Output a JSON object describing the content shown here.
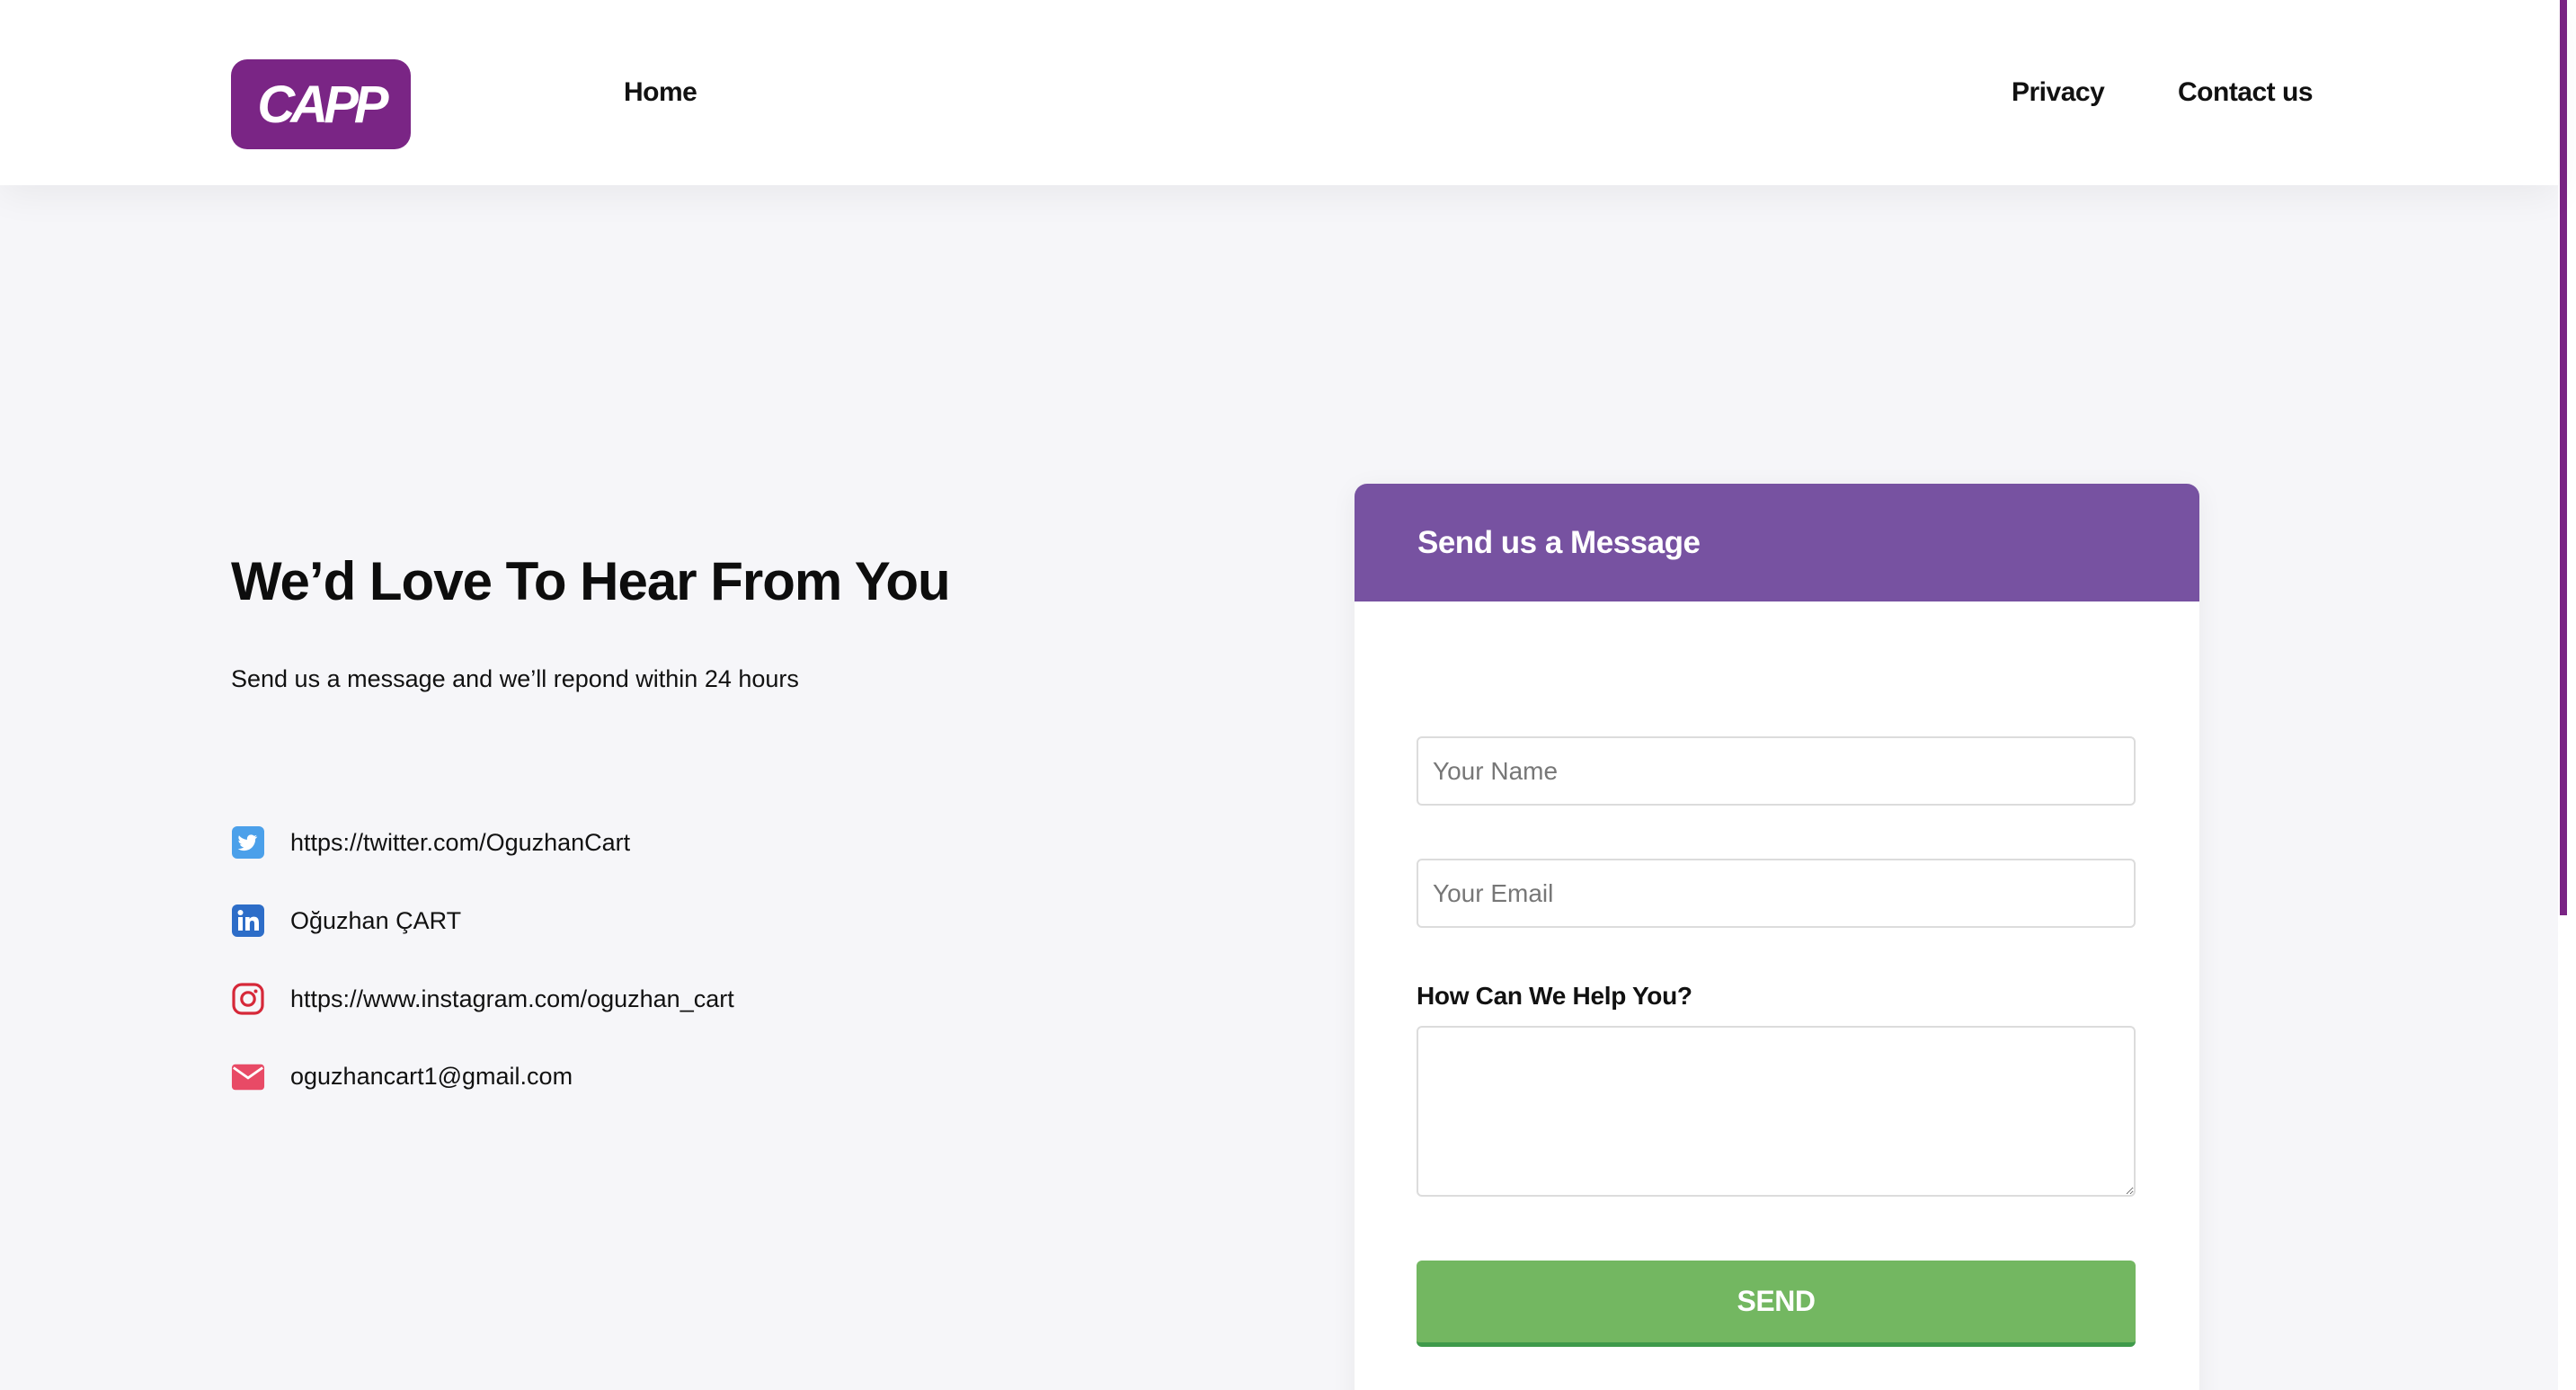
{
  "header": {
    "logo_text": "CAPP",
    "nav": {
      "home": "Home",
      "privacy": "Privacy",
      "contact": "Contact us"
    }
  },
  "intro": {
    "heading": "We’d Love To Hear From You",
    "subtext": "Send us a message and we’ll repond within 24 hours"
  },
  "contacts": {
    "twitter": {
      "icon": "twitter-icon",
      "text": "https://twitter.com/OguzhanCart"
    },
    "linkedin": {
      "icon": "linkedin-icon",
      "text": "Oğuzhan ÇART"
    },
    "instagram": {
      "icon": "instagram-icon",
      "text": "https://www.instagram.com/oguzhan_cart"
    },
    "email": {
      "icon": "mail-icon",
      "text": "oguzhancart1@gmail.com"
    }
  },
  "form": {
    "title": "Send us a Message",
    "name_placeholder": "Your Name",
    "email_placeholder": "Your Email",
    "help_label": "How Can We Help You?",
    "send_label": "SEND"
  },
  "colors": {
    "brand": "#7a2585",
    "card_header": "#7752a1",
    "send_button": "#73b761",
    "background": "#f6f6f9"
  }
}
